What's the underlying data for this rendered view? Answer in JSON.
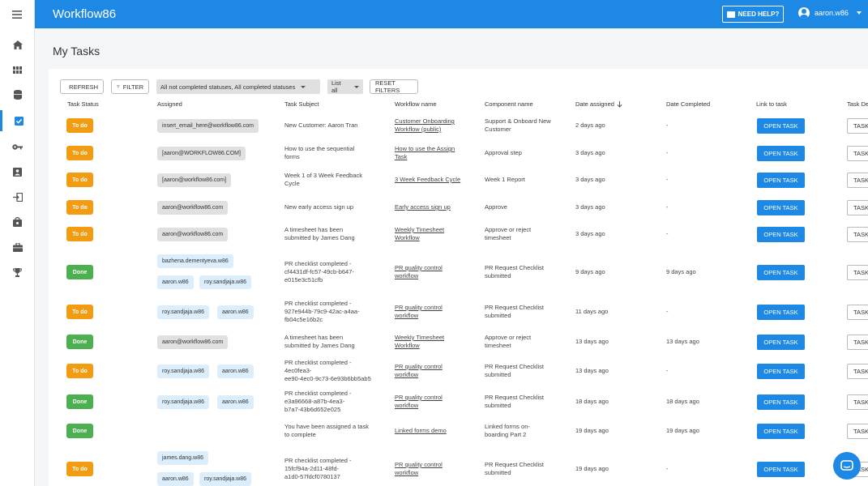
{
  "app": {
    "title": "Workflow86",
    "help_label": "NEED HELP?",
    "user_name": "aaron.w86"
  },
  "page": {
    "title": "My Tasks"
  },
  "toolbar": {
    "refresh_label": "REFRESH",
    "filter_label": "FILTER",
    "status_filter": "All not completed statuses, All completed statuses",
    "list_select": "List all",
    "reset_label": "RESET FILTERS"
  },
  "columns": [
    "Task Status",
    "Assigned",
    "Task Subject",
    "Workflow name",
    "Component name",
    "Date assigned",
    "Date Completed",
    "Link to task",
    "Task De"
  ],
  "open_label": "OPEN TASK",
  "task_label": "TASK",
  "colors": {
    "brand": "#1e88e5",
    "todo": "#f39c12",
    "done": "#4caf50"
  },
  "rows": [
    {
      "status": "To do",
      "assigned": [
        "insert_email_here@workflow86.com"
      ],
      "subject": [
        "New Customer: Aaron Tran"
      ],
      "workflow": [
        "Customer Onboarding",
        "Workflow (public)"
      ],
      "component": [
        "Support & Onboard New",
        "Customer"
      ],
      "date_assigned": "2 days ago",
      "date_completed": "-"
    },
    {
      "status": "To do",
      "assigned": [
        "[aaron@WORKFLOW86.COM]"
      ],
      "subject": [
        "How to use the sequential",
        "forms"
      ],
      "workflow": [
        "How to use the Assign",
        "Task"
      ],
      "component": [
        "Approval step"
      ],
      "date_assigned": "3 days ago",
      "date_completed": "-"
    },
    {
      "status": "To do",
      "assigned": [
        "[aaron@workflow86.com]"
      ],
      "subject": [
        "Week 1 of 3 Week Feedback",
        "Cycle"
      ],
      "workflow": [
        "3 Week Feedback Cycle"
      ],
      "component": [
        "Week 1 Report"
      ],
      "date_assigned": "3 days ago",
      "date_completed": "-"
    },
    {
      "status": "To do",
      "assigned": [
        "aaron@workflow86.com"
      ],
      "subject": [
        "New early access sign up"
      ],
      "workflow": [
        "Early access sign up"
      ],
      "component": [
        "Approve"
      ],
      "date_assigned": "3 days ago",
      "date_completed": "-"
    },
    {
      "status": "To do",
      "assigned": [
        "aaron@workflow86.com"
      ],
      "subject": [
        "A timesheet has been",
        "submitted by James Dang"
      ],
      "workflow": [
        "Weekly Timesheet",
        "Workflow"
      ],
      "component": [
        "Approve or reject",
        "timesheet"
      ],
      "date_assigned": "3 days ago",
      "date_completed": "-"
    },
    {
      "status": "Done",
      "assigned": [
        "bazhena.dementyeva.w86",
        "aaron.w86",
        "roy.sandjaja.w86"
      ],
      "subject": [
        "PR checklist completed -",
        "cf4431df-fc57-49cb-b647-",
        "e015e3c51cfb"
      ],
      "workflow": [
        "PR quality control",
        "workflow"
      ],
      "component": [
        "PR Request Checklist",
        "submitted"
      ],
      "date_assigned": "9 days ago",
      "date_completed": "9 days ago"
    },
    {
      "status": "To do",
      "assigned": [
        "roy.sandjaja.w86",
        "aaron.w86"
      ],
      "subject": [
        "PR checklist completed -",
        "927e944b-79c9-42ac-a4aa-",
        "fb04c5e16b2c"
      ],
      "workflow": [
        "PR quality control",
        "workflow"
      ],
      "component": [
        "PR Request Checklist",
        "submitted"
      ],
      "date_assigned": "11 days ago",
      "date_completed": "-"
    },
    {
      "status": "Done",
      "assigned": [
        "aaron@workflow86.com"
      ],
      "subject": [
        "A timesheet has been",
        "submitted by James Dang"
      ],
      "workflow": [
        "Weekly Timesheet",
        "Workflow"
      ],
      "component": [
        "Approve or reject",
        "timesheet"
      ],
      "date_assigned": "13 days ago",
      "date_completed": "13 days ago"
    },
    {
      "status": "To do",
      "assigned": [
        "roy.sandjaja.w86",
        "aaron.w86"
      ],
      "subject": [
        "PR checklist completed -",
        "4ec0fea3-",
        "ee90-4ec0-9c73-6e93b6bb5ab5"
      ],
      "workflow": [
        "PR quality control",
        "workflow"
      ],
      "component": [
        "PR Request Checklist",
        "submitted"
      ],
      "date_assigned": "13 days ago",
      "date_completed": "-"
    },
    {
      "status": "Done",
      "assigned": [
        "roy.sandjaja.w86",
        "aaron.w86"
      ],
      "subject": [
        "PR checklist completed -",
        "e3a96668-a87b-4ea3-",
        "b7a7-43b6d652e025"
      ],
      "workflow": [
        "PR quality control",
        "workflow"
      ],
      "component": [
        "PR Request Checklist",
        "submitted"
      ],
      "date_assigned": "18 days ago",
      "date_completed": "18 days ago"
    },
    {
      "status": "Done",
      "assigned": [],
      "subject": [
        "You have been assigned a task",
        "to complete"
      ],
      "workflow": [
        "Linked forms demo"
      ],
      "component": [
        "Linked forms on-",
        "boarding Part 2"
      ],
      "date_assigned": "19 days ago",
      "date_completed": "19 days ago"
    },
    {
      "status": "To do",
      "assigned": [
        "james.dang.w86",
        "aaron.w86",
        "roy.sandjaja.w86"
      ],
      "subject": [
        "PR checklist completed -",
        "15fcf94a-2d11-48fd-",
        "a1d0-57fdcf0780137"
      ],
      "workflow": [
        "PR quality control",
        "workflow"
      ],
      "component": [
        "PR Request Checklist",
        "submitted"
      ],
      "date_assigned": "19 days ago",
      "date_completed": "-"
    }
  ]
}
